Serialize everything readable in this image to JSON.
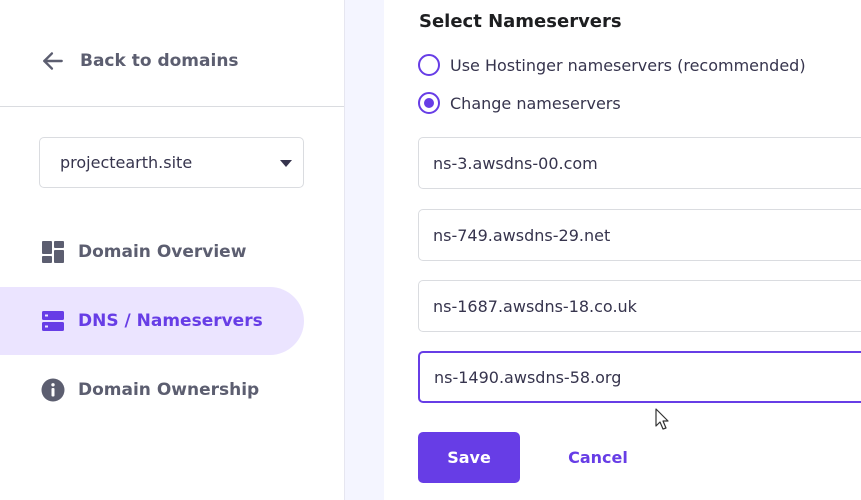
{
  "sidebar": {
    "back_label": "Back to domains",
    "domain_select": {
      "value": "projectearth.site"
    },
    "items": [
      {
        "label": "Domain Overview",
        "icon": "grid-icon",
        "active": false
      },
      {
        "label": "DNS / Nameservers",
        "icon": "server-icon",
        "active": true
      },
      {
        "label": "Domain Ownership",
        "icon": "info-icon",
        "active": false
      }
    ]
  },
  "main": {
    "section_title": "Select Nameservers",
    "options": [
      {
        "label": "Use Hostinger nameservers (recommended)",
        "checked": false
      },
      {
        "label": "Change nameservers",
        "checked": true
      }
    ],
    "nameservers": [
      "ns-3.awsdns-00.com",
      "ns-749.awsdns-29.net",
      "ns-1687.awsdns-18.co.uk",
      "ns-1490.awsdns-58.org"
    ],
    "save_label": "Save",
    "cancel_label": "Cancel"
  },
  "colors": {
    "accent": "#673de6",
    "active_bg": "#ebe4ff",
    "muted_text": "#5c5e70",
    "gutter": "#f4f5ff"
  }
}
